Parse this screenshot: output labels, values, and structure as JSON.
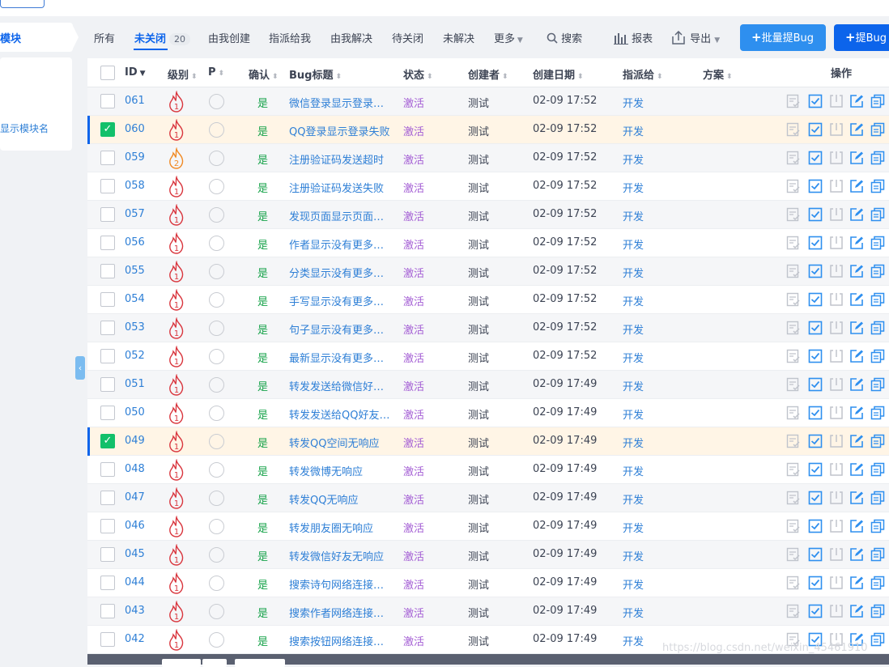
{
  "sidebar": {
    "module_label": "模块",
    "hint": "显示模块名"
  },
  "tabs": [
    {
      "label": "所有"
    },
    {
      "label": "未关闭",
      "count": "20"
    },
    {
      "label": "由我创建"
    },
    {
      "label": "指派给我"
    },
    {
      "label": "由我解决"
    },
    {
      "label": "待关闭"
    },
    {
      "label": "未解决"
    },
    {
      "label": "更多"
    }
  ],
  "toolbar": {
    "search": "搜索",
    "report": "报表",
    "export": "导出",
    "batch_add": "批量提Bug",
    "add": "提Bug"
  },
  "columns": {
    "id": "ID",
    "severity": "级别",
    "priority": "P",
    "confirmed": "确认",
    "title": "Bug标题",
    "status": "状态",
    "creator": "创建者",
    "created": "创建日期",
    "assigned": "指派给",
    "solution": "方案",
    "actions": "操作"
  },
  "rows": [
    {
      "id": "061",
      "sev": "1",
      "confirmed": "是",
      "title": "微信登录显示登录…",
      "status": "激活",
      "creator": "测试",
      "date": "02-09 17:52",
      "assigned": "开发",
      "selected": false
    },
    {
      "id": "060",
      "sev": "1",
      "confirmed": "是",
      "title": "QQ登录显示登录失败",
      "status": "激活",
      "creator": "测试",
      "date": "02-09 17:52",
      "assigned": "开发",
      "selected": true
    },
    {
      "id": "059",
      "sev": "2",
      "confirmed": "是",
      "title": "注册验证码发送超时",
      "status": "激活",
      "creator": "测试",
      "date": "02-09 17:52",
      "assigned": "开发",
      "selected": false
    },
    {
      "id": "058",
      "sev": "1",
      "confirmed": "是",
      "title": "注册验证码发送失败",
      "status": "激活",
      "creator": "测试",
      "date": "02-09 17:52",
      "assigned": "开发",
      "selected": false
    },
    {
      "id": "057",
      "sev": "1",
      "confirmed": "是",
      "title": "发现页面显示页面…",
      "status": "激活",
      "creator": "测试",
      "date": "02-09 17:52",
      "assigned": "开发",
      "selected": false
    },
    {
      "id": "056",
      "sev": "1",
      "confirmed": "是",
      "title": "作者显示没有更多…",
      "status": "激活",
      "creator": "测试",
      "date": "02-09 17:52",
      "assigned": "开发",
      "selected": false
    },
    {
      "id": "055",
      "sev": "1",
      "confirmed": "是",
      "title": "分类显示没有更多…",
      "status": "激活",
      "creator": "测试",
      "date": "02-09 17:52",
      "assigned": "开发",
      "selected": false
    },
    {
      "id": "054",
      "sev": "1",
      "confirmed": "是",
      "title": "手写显示没有更多…",
      "status": "激活",
      "creator": "测试",
      "date": "02-09 17:52",
      "assigned": "开发",
      "selected": false
    },
    {
      "id": "053",
      "sev": "1",
      "confirmed": "是",
      "title": "句子显示没有更多…",
      "status": "激活",
      "creator": "测试",
      "date": "02-09 17:52",
      "assigned": "开发",
      "selected": false
    },
    {
      "id": "052",
      "sev": "1",
      "confirmed": "是",
      "title": "最新显示没有更多…",
      "status": "激活",
      "creator": "测试",
      "date": "02-09 17:52",
      "assigned": "开发",
      "selected": false
    },
    {
      "id": "051",
      "sev": "1",
      "confirmed": "是",
      "title": "转发发送给微信好…",
      "status": "激活",
      "creator": "测试",
      "date": "02-09 17:49",
      "assigned": "开发",
      "selected": false
    },
    {
      "id": "050",
      "sev": "1",
      "confirmed": "是",
      "title": "转发发送给QQ好友…",
      "status": "激活",
      "creator": "测试",
      "date": "02-09 17:49",
      "assigned": "开发",
      "selected": false
    },
    {
      "id": "049",
      "sev": "1",
      "confirmed": "是",
      "title": "转发QQ空间无响应",
      "status": "激活",
      "creator": "测试",
      "date": "02-09 17:49",
      "assigned": "开发",
      "selected": true
    },
    {
      "id": "048",
      "sev": "1",
      "confirmed": "是",
      "title": "转发微博无响应",
      "status": "激活",
      "creator": "测试",
      "date": "02-09 17:49",
      "assigned": "开发",
      "selected": false
    },
    {
      "id": "047",
      "sev": "1",
      "confirmed": "是",
      "title": "转发QQ无响应",
      "status": "激活",
      "creator": "测试",
      "date": "02-09 17:49",
      "assigned": "开发",
      "selected": false
    },
    {
      "id": "046",
      "sev": "1",
      "confirmed": "是",
      "title": "转发朋友圈无响应",
      "status": "激活",
      "creator": "测试",
      "date": "02-09 17:49",
      "assigned": "开发",
      "selected": false
    },
    {
      "id": "045",
      "sev": "1",
      "confirmed": "是",
      "title": "转发微信好友无响应",
      "status": "激活",
      "creator": "测试",
      "date": "02-09 17:49",
      "assigned": "开发",
      "selected": false
    },
    {
      "id": "044",
      "sev": "1",
      "confirmed": "是",
      "title": "搜索诗句网络连接…",
      "status": "激活",
      "creator": "测试",
      "date": "02-09 17:49",
      "assigned": "开发",
      "selected": false
    },
    {
      "id": "043",
      "sev": "1",
      "confirmed": "是",
      "title": "搜索作者网络连接…",
      "status": "激活",
      "creator": "测试",
      "date": "02-09 17:49",
      "assigned": "开发",
      "selected": false
    },
    {
      "id": "042",
      "sev": "1",
      "confirmed": "是",
      "title": "搜索按钮网络连接…",
      "status": "激活",
      "creator": "测试",
      "date": "02-09 17:49",
      "assigned": "开发",
      "selected": false
    }
  ],
  "action_icons": [
    "confirm-icon",
    "resolve-icon",
    "close-icon",
    "edit-icon",
    "copy-icon"
  ],
  "colors": {
    "accent": "#0c64eb",
    "link": "#2e7fd6",
    "status_active": "#a35dd4",
    "confirmed_yes": "#17a34a",
    "sev1": "#d9363e",
    "sev2": "#f08a24",
    "selected_row": "#fff5e6",
    "check_on": "#12c06a"
  },
  "watermark": "https://blog.csdn.net/weixin_45461910"
}
